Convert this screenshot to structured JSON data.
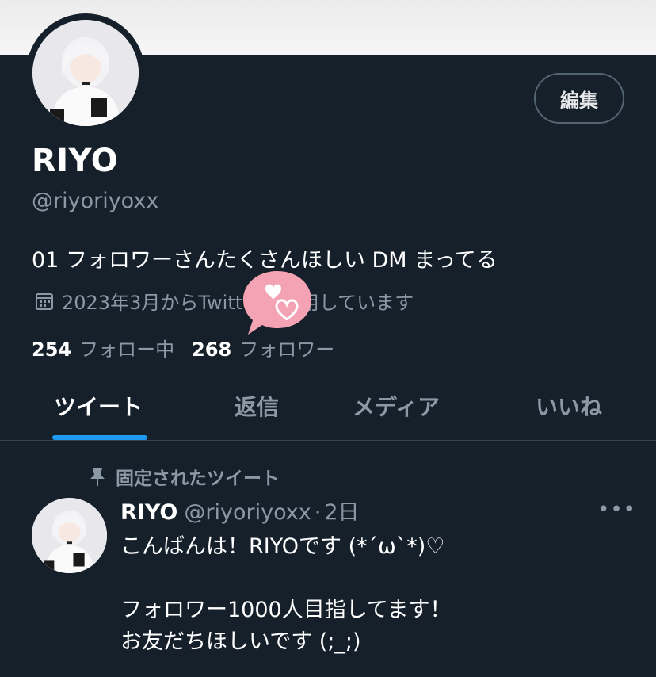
{
  "profile": {
    "edit_label": "編集",
    "display_name": "RIYO",
    "handle": "@riyoriyoxx",
    "bio": "01 フォロワーさんたくさんほしい DM まってる",
    "joined": "2023年3月からTwitterを利用しています",
    "following_count": "254",
    "following_label": "フォロー中",
    "followers_count": "268",
    "followers_label": "フォロワー"
  },
  "tabs": [
    {
      "label": "ツイート",
      "active": true
    },
    {
      "label": "返信",
      "active": false
    },
    {
      "label": "メディア",
      "active": false
    },
    {
      "label": "いいね",
      "active": false
    }
  ],
  "pinned_tweet": {
    "pinned_label": "固定されたツイート",
    "author_name": "RIYO",
    "author_handle": "@riyoriyoxx",
    "separator": "·",
    "age": "2日",
    "more_icon": "more-icon",
    "text": "こんばんは！RIYOです (*´ω`*)♡\n\nフォロワー1000人目指してます！\nお友だちほしいです (;_;)"
  },
  "colors": {
    "background": "#15202b",
    "accent": "#1d9bf0",
    "muted_text": "#8b98a5",
    "sticker_pink": "#f3a3b3"
  }
}
